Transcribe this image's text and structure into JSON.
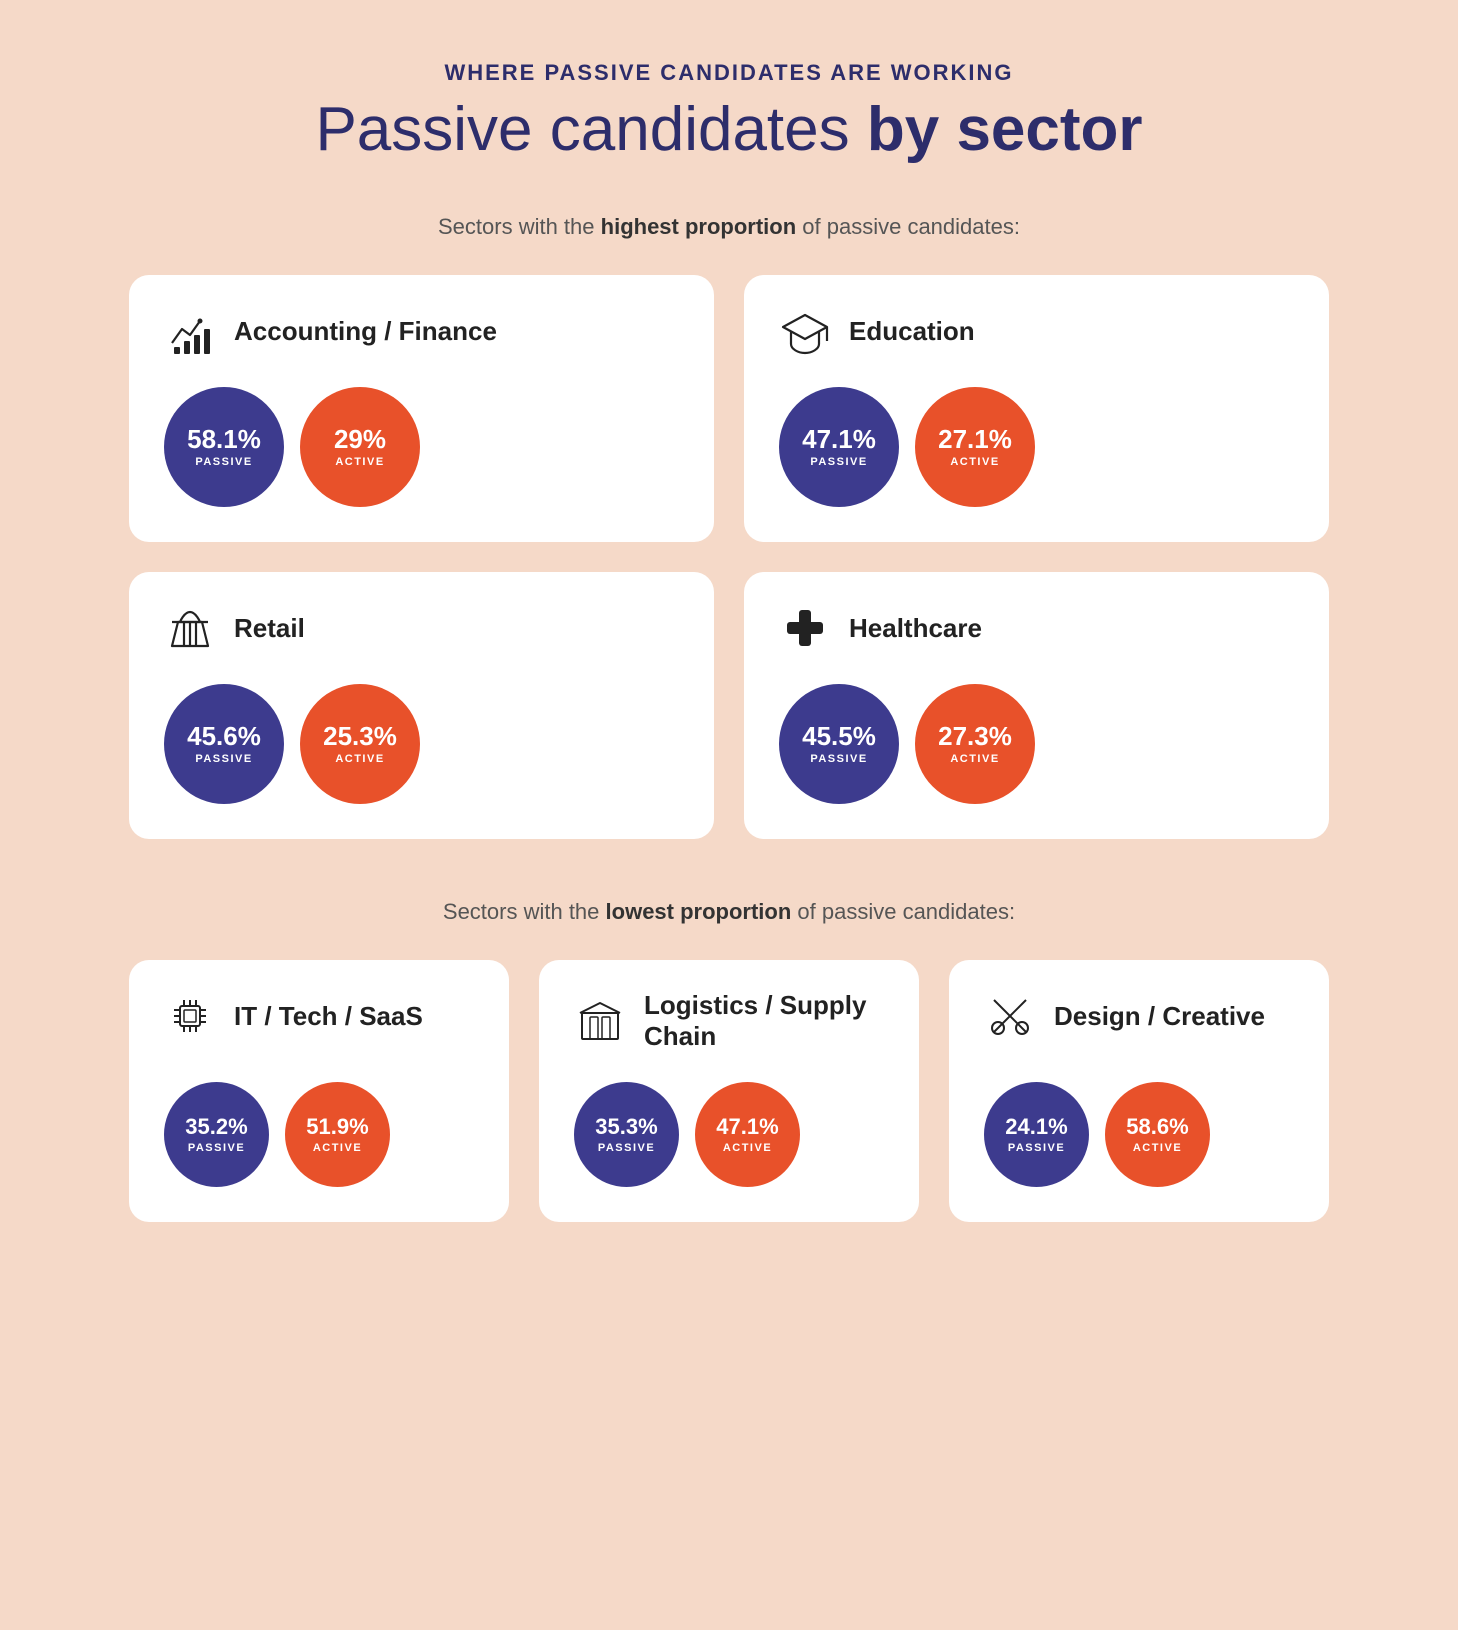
{
  "header": {
    "subtitle": "WHERE PASSIVE CANDIDATES ARE WORKING",
    "title_plain": "Passive candidates ",
    "title_bold": "by sector"
  },
  "highest_section": {
    "label_plain": "Sectors with the ",
    "label_bold": "highest proportion",
    "label_suffix": " of passive candidates:"
  },
  "lowest_section": {
    "label_plain": "Sectors with the ",
    "label_bold": "lowest proportion",
    "label_suffix": " of passive candidates:"
  },
  "highest_cards": [
    {
      "id": "accounting-finance",
      "title": "Accounting / Finance",
      "icon": "finance-icon",
      "passive_value": "58.1%",
      "passive_label": "PASSIVE",
      "active_value": "29%",
      "active_label": "ACTIVE"
    },
    {
      "id": "education",
      "title": "Education",
      "icon": "education-icon",
      "passive_value": "47.1%",
      "passive_label": "PASSIVE",
      "active_value": "27.1%",
      "active_label": "ACTIVE"
    },
    {
      "id": "retail",
      "title": "Retail",
      "icon": "retail-icon",
      "passive_value": "45.6%",
      "passive_label": "PASSIVE",
      "active_value": "25.3%",
      "active_label": "ACTIVE"
    },
    {
      "id": "healthcare",
      "title": "Healthcare",
      "icon": "healthcare-icon",
      "passive_value": "45.5%",
      "passive_label": "PASSIVE",
      "active_value": "27.3%",
      "active_label": "ACTIVE"
    }
  ],
  "lowest_cards": [
    {
      "id": "it-tech",
      "title": "IT / Tech / SaaS",
      "icon": "tech-icon",
      "passive_value": "35.2%",
      "passive_label": "PASSIVE",
      "active_value": "51.9%",
      "active_label": "ACTIVE"
    },
    {
      "id": "logistics",
      "title": "Logistics / Supply Chain",
      "icon": "logistics-icon",
      "passive_value": "35.3%",
      "passive_label": "PASSIVE",
      "active_value": "47.1%",
      "active_label": "ACTIVE"
    },
    {
      "id": "design-creative",
      "title": "Design / Creative",
      "icon": "design-icon",
      "passive_value": "24.1%",
      "passive_label": "PASSIVE",
      "active_value": "58.6%",
      "active_label": "ACTIVE"
    }
  ],
  "colors": {
    "passive": "#3d3b8e",
    "active": "#e8512a",
    "background": "#f5d9c8",
    "card": "#ffffff",
    "title": "#2d2d6b"
  }
}
